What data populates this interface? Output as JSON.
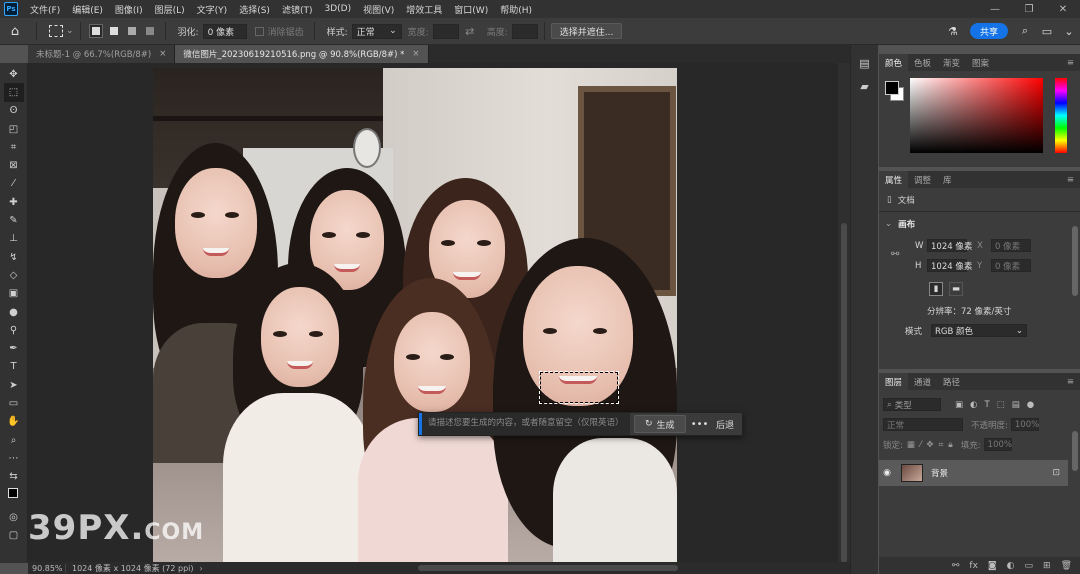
{
  "menubar": {
    "logo": "Ps",
    "items": [
      "文件(F)",
      "编辑(E)",
      "图像(I)",
      "图层(L)",
      "文字(Y)",
      "选择(S)",
      "滤镜(T)",
      "3D(D)",
      "视图(V)",
      "增效工具",
      "窗口(W)",
      "帮助(H)"
    ],
    "window_controls": [
      "—",
      "❐",
      "✕"
    ]
  },
  "options": {
    "feather_label": "羽化:",
    "feather_value": "0 像素",
    "antialias_label": "消除锯齿",
    "style_label": "样式:",
    "style_value": "正常",
    "width_label": "宽度:",
    "height_label": "高度:",
    "select_mask_button": "选择并遮住...",
    "share_button": "共享"
  },
  "tabs": [
    {
      "label": "未标题-1 @ 66.7%(RGB/8#)",
      "close": "×"
    },
    {
      "label": "微信图片_20230619210516.png @ 90.8%(RGB/8#) *",
      "close": "×"
    }
  ],
  "context_bar": {
    "prompt_placeholder": "请描述您要生成的内容，或者随意留空（仅限英语）",
    "generate_label": "生成",
    "more_label": "•••",
    "back_label": "后退"
  },
  "watermark": {
    "main": "39PX.",
    "suffix": "COM"
  },
  "status": {
    "zoom": "90.85%",
    "info": "1024 像素 x 1024 像素 (72 ppi)",
    "arrow": "›"
  },
  "color_panel": {
    "tabs": [
      "颜色",
      "色板",
      "渐变",
      "图案"
    ]
  },
  "properties_panel": {
    "tabs": [
      "属性",
      "调整",
      "库"
    ],
    "doc_label": "文档",
    "section_label": "画布",
    "w_label": "W",
    "w_value": "1024 像素",
    "h_label": "H",
    "h_value": "1024 像素",
    "x_label": "X",
    "x_placeholder": "0 像素",
    "y_label": "Y",
    "y_placeholder": "0 像素",
    "resolution": "分辨率：72 像素/英寸",
    "mode_label": "模式",
    "mode_value": "RGB 颜色"
  },
  "layers_panel": {
    "tabs": [
      "图层",
      "通道",
      "路径"
    ],
    "filter_label": "类型",
    "blend_mode": "正常",
    "opacity_label": "不透明度:",
    "opacity_value": "100%",
    "lock_label": "锁定:",
    "fill_label": "填充:",
    "fill_value": "100%",
    "layer_name": "背景"
  },
  "colors": {
    "accent": "#1473e6",
    "panel_bg": "#3c3c3c",
    "dark_bg": "#323232"
  }
}
